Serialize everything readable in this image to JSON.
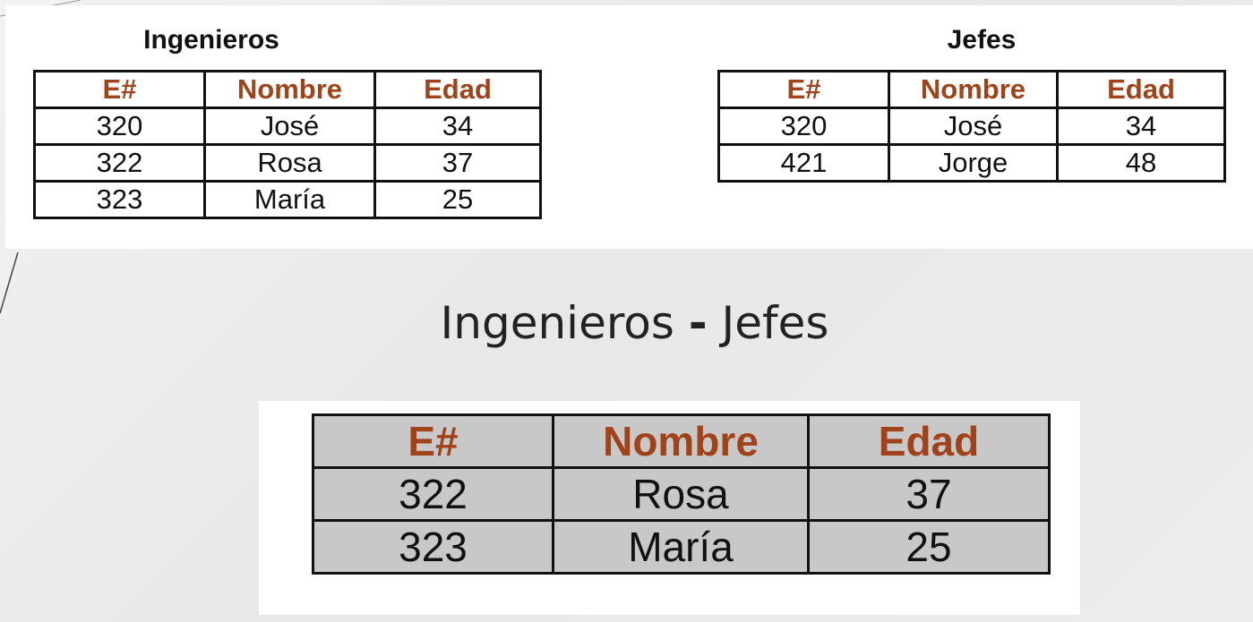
{
  "left_table": {
    "caption": "Ingenieros",
    "headers": [
      "E#",
      "Nombre",
      "Edad"
    ],
    "rows": [
      [
        "320",
        "José",
        "34"
      ],
      [
        "322",
        "Rosa",
        "37"
      ],
      [
        "323",
        "María",
        "25"
      ]
    ]
  },
  "right_table": {
    "caption": "Jefes",
    "headers": [
      "E#",
      "Nombre",
      "Edad"
    ],
    "rows": [
      [
        "320",
        "José",
        "34"
      ],
      [
        "421",
        "Jorge",
        "48"
      ]
    ]
  },
  "operation": {
    "left": "Ingenieros",
    "operator": "-",
    "right": "Jefes"
  },
  "result_table": {
    "headers": [
      "E#",
      "Nombre",
      "Edad"
    ],
    "rows": [
      [
        "322",
        "Rosa",
        "37"
      ],
      [
        "323",
        "María",
        "25"
      ]
    ]
  },
  "colors": {
    "header_text": "#a0431a",
    "result_fill": "#c8c8c8"
  }
}
